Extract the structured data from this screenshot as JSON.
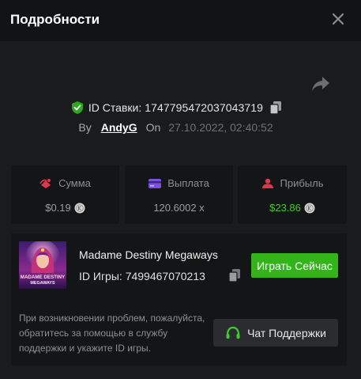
{
  "header": {
    "title": "Подробности",
    "close_icon": "close-icon"
  },
  "share_icon": "share-icon",
  "bet": {
    "id_label": "ID Ставки:",
    "id_value": "1747795472037043719",
    "by_label": "By",
    "user": "AndyG",
    "on_label": "On",
    "date": "27.10.2022, 02:40:52"
  },
  "stats": {
    "amount": {
      "label": "Сумма",
      "value": "$0.19",
      "icon": "sum-icon"
    },
    "payout": {
      "label": "Выплата",
      "value": "120.6002 x",
      "icon": "card-icon"
    },
    "profit": {
      "label": "Прибыль",
      "value": "$23.86",
      "icon": "profit-icon"
    }
  },
  "game": {
    "name": "Madame Destiny Megaways",
    "id_label": "ID Игры:",
    "id_value": "7499467070213",
    "play_label": "Играть Сейчас",
    "thumb_text_1": "MADAME DESTINY",
    "thumb_text_2": "MEGAWAYS"
  },
  "help": {
    "text": "При возникновении проблем, пожалуйста, обратитесь за помощью в службу поддержки и укажите ID игры.",
    "support_label": "Чат Поддержки"
  },
  "colors": {
    "accent_green": "#33b51a",
    "profit_green": "#3fcb2b",
    "background": "#1a1b1d",
    "header": "#121314"
  }
}
